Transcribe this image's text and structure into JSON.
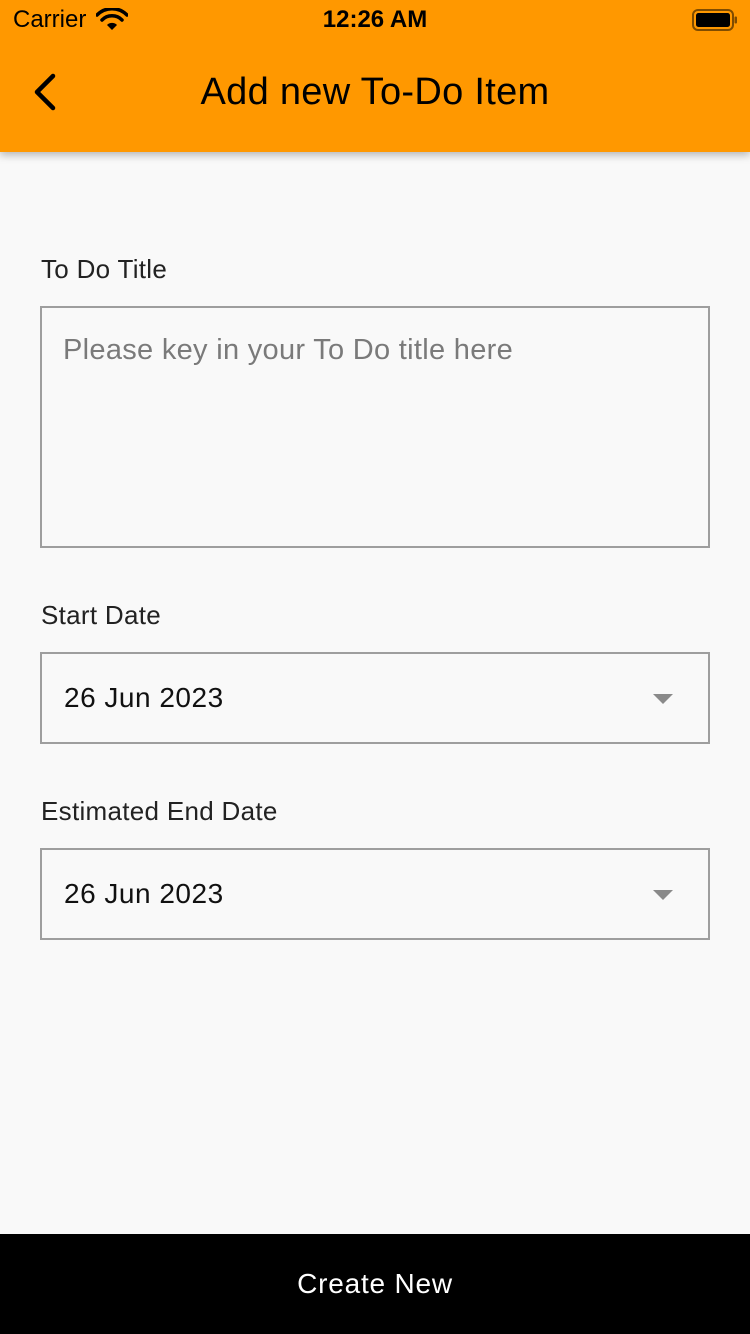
{
  "status_bar": {
    "carrier": "Carrier",
    "time": "12:26 AM",
    "wifi_icon": "wifi-icon",
    "battery_icon": "battery-icon"
  },
  "app_bar": {
    "title": "Add new To-Do Item",
    "back_icon": "chevron-left-icon",
    "color": "#ff9800"
  },
  "form": {
    "title_label": "To Do Title",
    "title_placeholder": "Please key in your To Do title here",
    "title_value": "",
    "start_date_label": "Start Date",
    "start_date_value": "26 Jun 2023",
    "end_date_label": "Estimated End Date",
    "end_date_value": "26 Jun 2023"
  },
  "footer": {
    "create_label": "Create New",
    "color": "#000000"
  }
}
